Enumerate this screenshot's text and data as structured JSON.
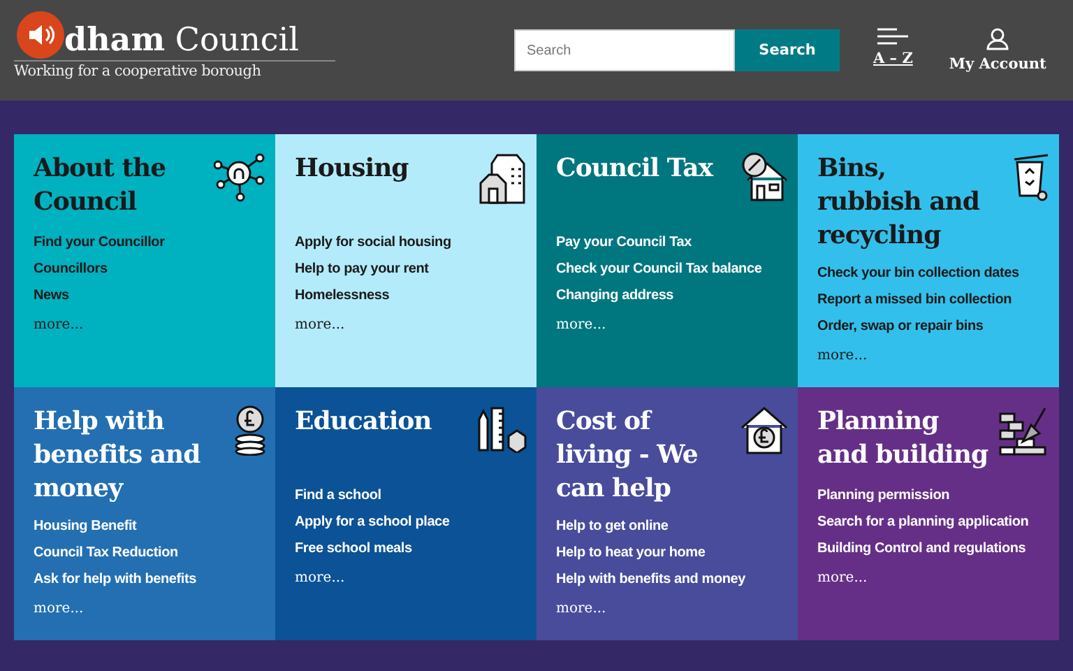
{
  "header": {
    "logo": "**dham** Council",
    "tagline": "Working for a cooperative borough",
    "search": {
      "placeholder": "Search",
      "button": "Search"
    },
    "az_link": "A – Z",
    "account": "My Account"
  },
  "tiles": [
    {
      "title": "About the Council",
      "color": "#00b1c0",
      "dark_text": true,
      "links": [
        "Find your Councillor",
        "Councillors",
        "News"
      ],
      "more": "more..."
    },
    {
      "title": "Housing",
      "color": "#b4ebfb",
      "dark_text": true,
      "links": [
        "Apply for social housing",
        "Help to pay your rent",
        "Homelessness"
      ],
      "more": "more..."
    },
    {
      "title": "Council Tax",
      "color": "#00767f",
      "dark_text": false,
      "links": [
        "Pay your Council Tax",
        "Check your Council Tax balance",
        "Changing address"
      ],
      "more": "more..."
    },
    {
      "title": "Bins, rubbish and recycling",
      "color": "#33bfeb",
      "dark_text": true,
      "links": [
        "Check your bin collection dates",
        "Report a missed bin collection",
        "Order, swap or repair bins"
      ],
      "more": "more..."
    },
    {
      "title": "Help with benefits and money",
      "color": "#236fb2",
      "dark_text": false,
      "links": [
        "Housing Benefit",
        "Council Tax Reduction",
        "Ask for help with benefits"
      ],
      "more": "more..."
    },
    {
      "title": "Education",
      "color": "#0b5296",
      "dark_text": false,
      "links": [
        "Find a school",
        "Apply for a school place",
        "Free school meals"
      ],
      "more": "more..."
    },
    {
      "title": "Cost of living - We can help",
      "color": "#484c9b",
      "dark_text": false,
      "links": [
        "Help to get online",
        "Help to heat your home",
        "Help with benefits and money"
      ],
      "more": "more..."
    },
    {
      "title": "Planning and building",
      "color": "#652f87",
      "dark_text": false,
      "links": [
        "Planning permission",
        "Search for a planning application",
        "Building Control and regulations"
      ],
      "more": "more..."
    }
  ]
}
